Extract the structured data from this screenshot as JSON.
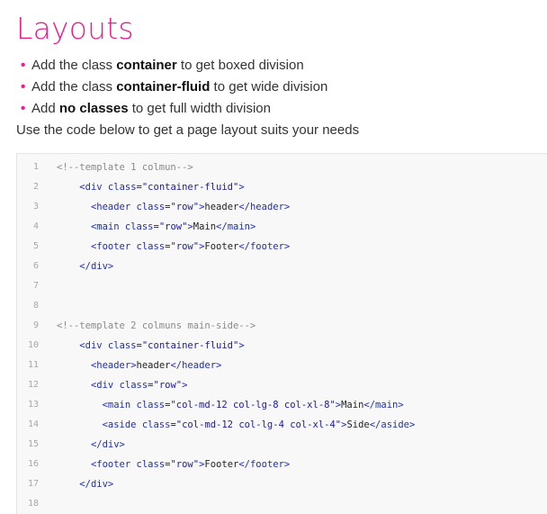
{
  "page": {
    "title": "Layouts",
    "accent_color": "#e91e8c",
    "bullets": [
      {
        "prefix": "Add the class ",
        "bold": "container",
        "suffix": " to get boxed division"
      },
      {
        "prefix": "Add the class ",
        "bold": "container-fluid",
        "suffix": " to get wide division"
      },
      {
        "prefix": "Add ",
        "bold": "no classes",
        "suffix": " to get full width division"
      }
    ],
    "bullet_glyph": "•",
    "intro": "Use the code below to get a page layout suits your needs"
  },
  "code": {
    "lines": [
      {
        "n": "1",
        "text": "<!--template 1 colmun-->"
      },
      {
        "n": "2",
        "text": "    <div class=\"container-fluid\">"
      },
      {
        "n": "3",
        "text": "      <header class=\"row\">header</header>"
      },
      {
        "n": "4",
        "text": "      <main class=\"row\">Main</main>"
      },
      {
        "n": "5",
        "text": "      <footer class=\"row\">Footer</footer>"
      },
      {
        "n": "6",
        "text": "    </div>"
      },
      {
        "n": "7",
        "text": ""
      },
      {
        "n": "8",
        "text": ""
      },
      {
        "n": "9",
        "text": "<!--template 2 colmuns main-side-->"
      },
      {
        "n": "10",
        "text": "    <div class=\"container-fluid\">"
      },
      {
        "n": "11",
        "text": "      <header>header</header>"
      },
      {
        "n": "12",
        "text": "      <div class=\"row\">"
      },
      {
        "n": "13",
        "text": "        <main class=\"col-md-12 col-lg-8 col-xl-8\">Main</main>"
      },
      {
        "n": "14",
        "text": "        <aside class=\"col-md-12 col-lg-4 col-xl-4\">Side</aside>"
      },
      {
        "n": "15",
        "text": "      </div>"
      },
      {
        "n": "16",
        "text": "      <footer class=\"row\">Footer</footer>"
      },
      {
        "n": "17",
        "text": "    </div>"
      },
      {
        "n": "18",
        "text": ""
      }
    ]
  }
}
